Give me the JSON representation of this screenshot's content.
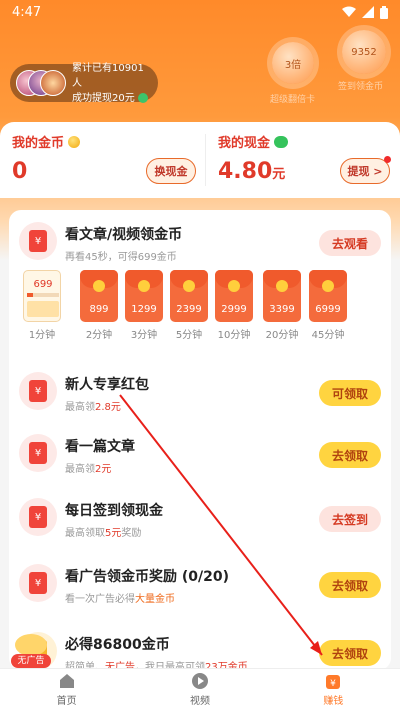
{
  "status_bar": {
    "time": "4:47"
  },
  "user": {
    "line1": "累计已有10901人",
    "line2": "成功提现20元"
  },
  "bubbles": [
    {
      "value": "3倍",
      "caption": "超级翻倍卡"
    },
    {
      "value": "9352",
      "caption": "签到领金币"
    }
  ],
  "wallet": {
    "coins_title": "我的金币",
    "coins_value": "0",
    "exchange_label": "换现金",
    "cash_title": "我的现金",
    "cash_value": "4.80",
    "cash_unit": "元",
    "withdraw_label": "提现 >"
  },
  "tasks": [
    {
      "title": "看文章/视频领金币",
      "sub_prefix": "再看45秒，可得699金币",
      "sub_hl": "",
      "sub_suffix": "",
      "button": "去观看",
      "style": "pink"
    },
    {
      "title": "新人专享红包",
      "sub_prefix": "最高领",
      "sub_hl": "2.8元",
      "sub_suffix": "",
      "button": "可领取",
      "style": "yellow"
    },
    {
      "title": "看一篇文章",
      "sub_prefix": "最高领",
      "sub_hl": "2元",
      "sub_suffix": "",
      "button": "去领取",
      "style": "yellow"
    },
    {
      "title": "每日签到领现金",
      "sub_prefix": "最高领取",
      "sub_hl": "5元",
      "sub_suffix": "奖励",
      "button": "去签到",
      "style": "pink"
    },
    {
      "title": "看广告领金币奖励",
      "title_count": "(0/20)",
      "sub_prefix": "看一次广告必得",
      "sub_hl": "大量金币",
      "sub_suffix": "",
      "button": "去领取",
      "style": "yellow"
    },
    {
      "title": "必得86800金币",
      "sub_prefix": "超简单、",
      "sub_hl": "无广告",
      "sub_suffix": "，我日最高可领",
      "sub_hl2": "23万金币",
      "button": "去领取",
      "style": "yellow"
    }
  ],
  "rewards": [
    {
      "amount": "699",
      "label": "1分钟"
    },
    {
      "amount": "899",
      "label": "2分钟"
    },
    {
      "amount": "1299",
      "label": "3分钟"
    },
    {
      "amount": "2399",
      "label": "5分钟"
    },
    {
      "amount": "2999",
      "label": "10分钟"
    },
    {
      "amount": "3399",
      "label": "20分钟"
    },
    {
      "amount": "6999",
      "label": "45分钟"
    }
  ],
  "reward_progress": 0.2,
  "noad_badge": "无广告",
  "tabs": [
    {
      "label": "首页",
      "icon": "home-icon"
    },
    {
      "label": "视频",
      "icon": "play-icon"
    },
    {
      "label": "赚钱",
      "icon": "money-bag-icon"
    }
  ],
  "colors": {
    "accent": "#ff7a2a",
    "red": "#e03a2a",
    "yellow_button": "#ffd440"
  }
}
